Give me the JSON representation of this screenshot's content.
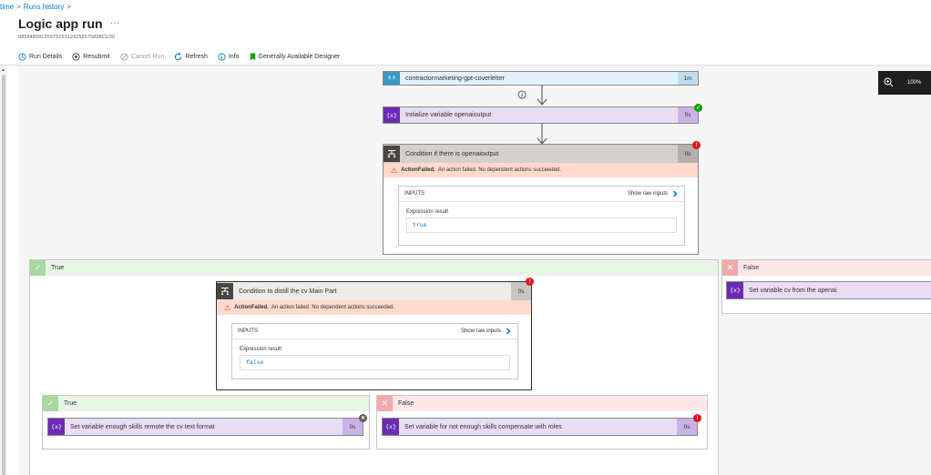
{
  "breadcrumb": {
    "item1": "time",
    "item2": "Runs history"
  },
  "header": {
    "title": "Logic app run",
    "more": "···",
    "run_id": "08584859135975153124258575898CU30"
  },
  "toolbar": {
    "run_details": "Run Details",
    "resubmit": "Resubmit",
    "cancel_run": "Cancel Run",
    "refresh": "Refresh",
    "info": "Info",
    "designer": "Generally Available Designer"
  },
  "zoom": {
    "level": "100%"
  },
  "top_action": {
    "title": "contractormarketing-gpt-coverletter",
    "duration": "1m"
  },
  "init_var": {
    "title": "Initialize variable openaioutput",
    "duration": "0s"
  },
  "condition1": {
    "title": "Condition if there is openaioutput",
    "duration": "0s",
    "error_code": "ActionFailed.",
    "error_msg": "An action failed. No dependent actions succeeded.",
    "inputs_label": "INPUTS",
    "show_raw": "Show raw inputs",
    "expr_label": "Expression result",
    "expr_value": "true"
  },
  "true_branch": {
    "label": "True"
  },
  "false_branch": {
    "label": "False",
    "action": "Set variable cv from the openai"
  },
  "condition2": {
    "title": "Condition to distill the cv Main Part",
    "duration": "0s",
    "error_code": "ActionFailed.",
    "error_msg": "An action failed. No dependent actions succeeded.",
    "inputs_label": "INPUTS",
    "show_raw": "Show raw inputs",
    "expr_label": "Expression result",
    "expr_value": "false"
  },
  "inner_true": {
    "label": "True",
    "action": "Set variable enough skills remote the cv text format",
    "duration": "0s"
  },
  "inner_false": {
    "label": "False",
    "action": "Set variable for not enough skills compensate with roles",
    "duration": "0s"
  },
  "icons": {
    "var": "{x}",
    "cond": "⊤⊥"
  },
  "colors": {
    "accent": "#0078d4",
    "success": "#13a10e",
    "error": "#e81123",
    "variable": "#6b2bb5"
  }
}
